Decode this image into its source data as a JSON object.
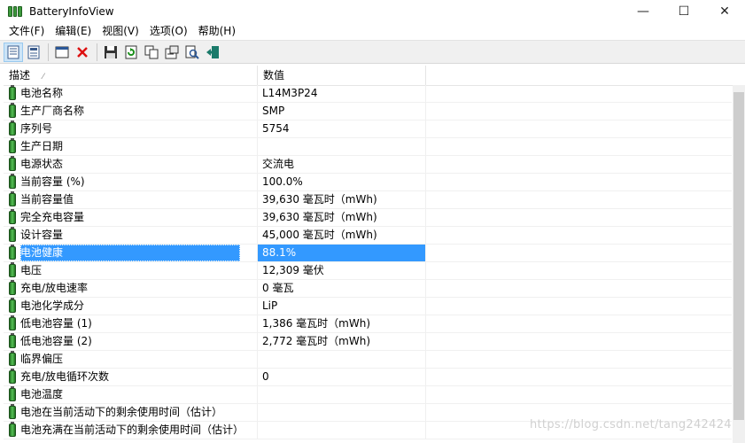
{
  "window": {
    "title": "BatteryInfoView"
  },
  "menu": [
    "文件(F)",
    "编辑(E)",
    "视图(V)",
    "选项(O)",
    "帮助(H)"
  ],
  "toolbar": {
    "icons": [
      "properties-icon",
      "html-report-icon",
      "window-icon",
      "delete-icon",
      "save-icon",
      "refresh-icon",
      "copy-icon",
      "properties-dialog-icon",
      "find-icon",
      "exit-icon"
    ]
  },
  "table": {
    "columns": [
      "描述",
      "数值"
    ],
    "rows": [
      {
        "label": "电池名称",
        "value": "L14M3P24"
      },
      {
        "label": "生产厂商名称",
        "value": "SMP"
      },
      {
        "label": "序列号",
        "value": " 5754"
      },
      {
        "label": "生产日期",
        "value": ""
      },
      {
        "label": "电源状态",
        "value": "交流电"
      },
      {
        "label": "当前容量 (%)",
        "value": "100.0%"
      },
      {
        "label": "当前容量值",
        "value": "39,630 毫瓦时（mWh)"
      },
      {
        "label": "完全充电容量",
        "value": "39,630 毫瓦时（mWh)"
      },
      {
        "label": "设计容量",
        "value": "45,000 毫瓦时（mWh)"
      },
      {
        "label": "电池健康",
        "value": "88.1%"
      },
      {
        "label": "电压",
        "value": "12,309 毫伏"
      },
      {
        "label": "充电/放电速率",
        "value": "0 毫瓦"
      },
      {
        "label": "电池化学成分",
        "value": "LiP"
      },
      {
        "label": "低电池容量 (1)",
        "value": "1,386 毫瓦时（mWh)"
      },
      {
        "label": "低电池容量 (2)",
        "value": "2,772 毫瓦时（mWh)"
      },
      {
        "label": "临界偏压",
        "value": ""
      },
      {
        "label": "充电/放电循环次数",
        "value": "0"
      },
      {
        "label": "电池温度",
        "value": ""
      },
      {
        "label": "电池在当前活动下的剩余使用时间（估计）",
        "value": ""
      },
      {
        "label": "电池充满在当前活动下的剩余使用时间（估计）",
        "value": ""
      }
    ],
    "selected_index": 9
  },
  "watermark": "https://blog.csdn.net/tang242424",
  "colors": {
    "selection": "#3399ff",
    "toolbar_bg": "#f0f0f0"
  }
}
